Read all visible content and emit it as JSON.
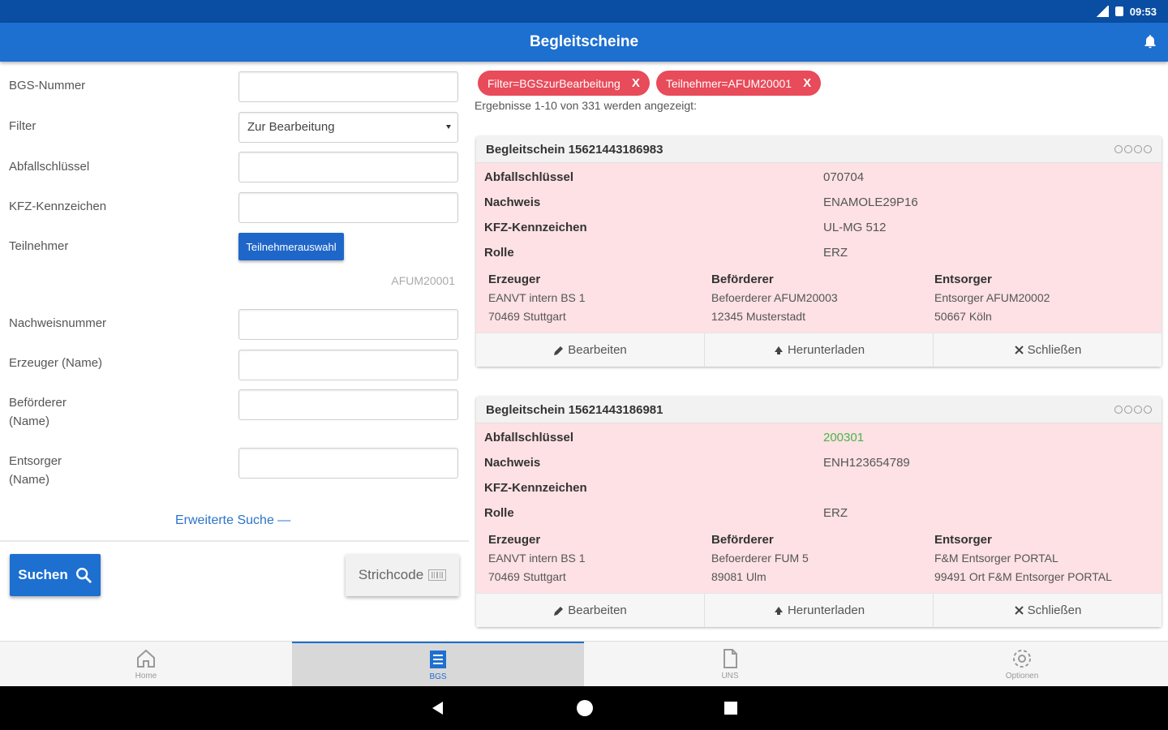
{
  "status": {
    "time": "09:53"
  },
  "appbar": {
    "title": "Begleitscheine"
  },
  "form": {
    "bgs_label": "BGS-Nummer",
    "filter_label": "Filter",
    "filter_value": "Zur Bearbeitung",
    "abfall_label": "Abfallschlüssel",
    "kfz_label": "KFZ-Kennzeichen",
    "teilnehmer_label": "Teilnehmer",
    "teilnehmer_button": "Teilnehmerauswahl",
    "teilnehmer_selected": "AFUM20001",
    "nachweis_label": "Nachweisnummer",
    "erzeuger_label": "Erzeuger (Name)",
    "befoerderer_label_1": "Beförderer",
    "befoerderer_label_2": "(Name)",
    "entsorger_label_1": "Entsorger",
    "entsorger_label_2": "(Name)",
    "erweitert": "Erweiterte Suche —",
    "suchen": "Suchen",
    "strichcode": "Strichcode"
  },
  "filters": {
    "chips": [
      {
        "label": "Filter=BGSzurBearbeitung",
        "x": "X"
      },
      {
        "label": "Teilnehmer=AFUM20001",
        "x": "X"
      }
    ],
    "results": "Ergebnisse 1-10 von 331 werden angezeigt:"
  },
  "cards": [
    {
      "title": "Begleitschein 15621443186983",
      "rows": [
        {
          "k": "Abfallschlüssel",
          "v": "070704"
        },
        {
          "k": "Nachweis",
          "v": "ENAMOLE29P16"
        },
        {
          "k": "KFZ-Kennzeichen",
          "v": "UL-MG 512"
        },
        {
          "k": "Rolle",
          "v": "ERZ"
        }
      ],
      "parties": [
        {
          "h": "Erzeuger",
          "l1": "EANVT intern BS 1",
          "l2": "70469 Stuttgart"
        },
        {
          "h": "Beförderer",
          "l1": "Befoerderer AFUM20003",
          "l2": "12345 Musterstadt"
        },
        {
          "h": "Entsorger",
          "l1": "Entsorger AFUM20002",
          "l2": "50667 Köln"
        }
      ],
      "actions": {
        "edit": "Bearbeiten",
        "download": "Herunterladen",
        "close": "Schließen"
      }
    },
    {
      "title": "Begleitschein 15621443186981",
      "rows": [
        {
          "k": "Abfallschlüssel",
          "v": "200301"
        },
        {
          "k": "Nachweis",
          "v": "ENH123654789"
        },
        {
          "k": "KFZ-Kennzeichen",
          "v": ""
        },
        {
          "k": "Rolle",
          "v": "ERZ"
        }
      ],
      "parties": [
        {
          "h": "Erzeuger",
          "l1": "EANVT intern BS 1",
          "l2": "70469 Stuttgart"
        },
        {
          "h": "Beförderer",
          "l1": "Befoerderer FUM 5",
          "l2": "89081 Ulm"
        },
        {
          "h": "Entsorger",
          "l1": "F&M Entsorger PORTAL",
          "l2": "99491 Ort F&M Entsorger PORTAL"
        }
      ],
      "actions": {
        "edit": "Bearbeiten",
        "download": "Herunterladen",
        "close": "Schließen"
      }
    }
  ],
  "nav": {
    "items": [
      {
        "label": "Home",
        "icon": "home-icon"
      },
      {
        "label": "BGS",
        "icon": "list-icon"
      },
      {
        "label": "UNS",
        "icon": "document-icon"
      },
      {
        "label": "Optionen",
        "icon": "gear-icon"
      }
    ],
    "active": "BGS"
  },
  "colors": {
    "appbar": "#1d6fd0",
    "statusbar": "#0a4ea3",
    "chip": "#e84b5a",
    "card_body": "#fde1e4",
    "green_value": "#49b449"
  }
}
